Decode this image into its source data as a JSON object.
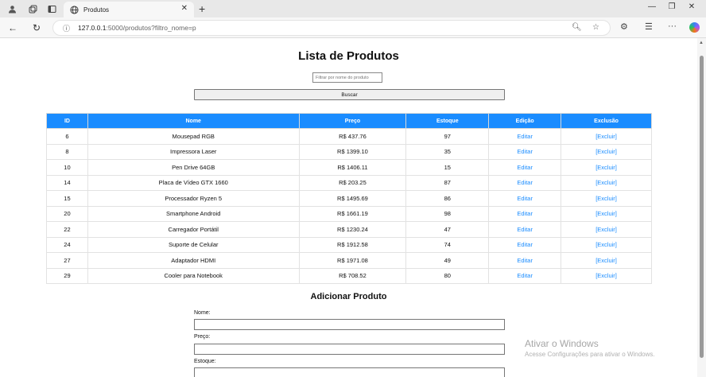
{
  "browser": {
    "tab_title": "Produtos",
    "url_host": "127.0.0.1",
    "url_path": ":5000/produtos?filtro_nome=p"
  },
  "page": {
    "title": "Lista de Produtos",
    "filter_placeholder": "Filtrar por nome do produto",
    "search_button": "Buscar",
    "columns": [
      "ID",
      "Nome",
      "Preço",
      "Estoque",
      "Edição",
      "Exclusão"
    ],
    "rows": [
      {
        "id": "6",
        "name": "Mousepad RGB",
        "price": "R$ 437.76",
        "stock": "97",
        "edit": "Editar",
        "delete": "[Excluir]"
      },
      {
        "id": "8",
        "name": "Impressora Laser",
        "price": "R$ 1399.10",
        "stock": "35",
        "edit": "Editar",
        "delete": "[Excluir]"
      },
      {
        "id": "10",
        "name": "Pen Drive 64GB",
        "price": "R$ 1406.11",
        "stock": "15",
        "edit": "Editar",
        "delete": "[Excluir]"
      },
      {
        "id": "14",
        "name": "Placa de Vídeo GTX 1660",
        "price": "R$ 203.25",
        "stock": "87",
        "edit": "Editar",
        "delete": "[Excluir]"
      },
      {
        "id": "15",
        "name": "Processador Ryzen 5",
        "price": "R$ 1495.69",
        "stock": "86",
        "edit": "Editar",
        "delete": "[Excluir]"
      },
      {
        "id": "20",
        "name": "Smartphone Android",
        "price": "R$ 1661.19",
        "stock": "98",
        "edit": "Editar",
        "delete": "[Excluir]"
      },
      {
        "id": "22",
        "name": "Carregador Portátil",
        "price": "R$ 1230.24",
        "stock": "47",
        "edit": "Editar",
        "delete": "[Excluir]"
      },
      {
        "id": "24",
        "name": "Suporte de Celular",
        "price": "R$ 1912.58",
        "stock": "74",
        "edit": "Editar",
        "delete": "[Excluir]"
      },
      {
        "id": "27",
        "name": "Adaptador HDMI",
        "price": "R$ 1971.08",
        "stock": "49",
        "edit": "Editar",
        "delete": "[Excluir]"
      },
      {
        "id": "29",
        "name": "Cooler para Notebook",
        "price": "R$ 708.52",
        "stock": "80",
        "edit": "Editar",
        "delete": "[Excluir]"
      }
    ],
    "add_title": "Adicionar Produto",
    "form": {
      "name_label": "Nome:",
      "price_label": "Preço:",
      "stock_label": "Estoque:"
    }
  },
  "watermark": {
    "title": "Ativar o Windows",
    "subtitle": "Acesse Configurações para ativar o Windows."
  },
  "colors": {
    "accent": "#1a8cff"
  }
}
